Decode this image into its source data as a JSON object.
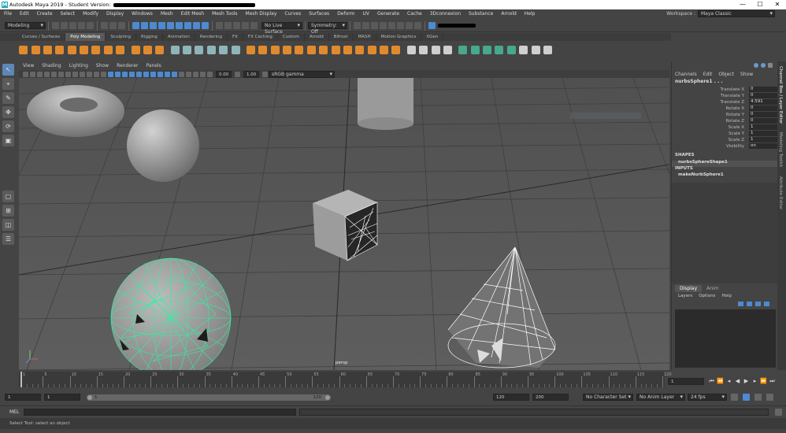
{
  "window": {
    "title": "Autodesk Maya 2019 - Student Version:",
    "logo_letter": "M",
    "minimize": "—",
    "maximize": "☐",
    "close": "✕"
  },
  "menus": [
    "File",
    "Edit",
    "Create",
    "Select",
    "Modify",
    "Display",
    "Windows",
    "Mesh",
    "Edit Mesh",
    "Mesh Tools",
    "Mesh Display",
    "Curves",
    "Surfaces",
    "Deform",
    "UV",
    "Generate",
    "Cache",
    "3Dconnexion",
    "Substance",
    "Arnold",
    "Help"
  ],
  "workspace": {
    "label": "Workspace :",
    "value": "Maya Classic"
  },
  "status_line": {
    "menu_set": "Modeling",
    "live_surface": "No Live Surface",
    "symmetry": "Symmetry: Off"
  },
  "shelf_tabs": [
    "Curves / Surfaces",
    "Poly Modeling",
    "Sculpting",
    "Rigging",
    "Animation",
    "Rendering",
    "FX",
    "FX Caching",
    "Custom",
    "Arnold",
    "Bifrost",
    "MASH",
    "Motion Graphics",
    "XGen"
  ],
  "active_shelf_tab": "Poly Modeling",
  "panel_menus": [
    "View",
    "Shading",
    "Lighting",
    "Show",
    "Renderer",
    "Panels"
  ],
  "panel_toolbar": {
    "exposure": "0.00",
    "gamma": "1.00",
    "color_space": "sRGB gamma"
  },
  "viewport": {
    "camera_label": "persp"
  },
  "channel_box": {
    "menus": [
      "Channels",
      "Edit",
      "Object",
      "Show"
    ],
    "node_name": "nurbsSphere1 . . .",
    "attributes": [
      {
        "name": "Translate X",
        "value": "0"
      },
      {
        "name": "Translate Y",
        "value": "0"
      },
      {
        "name": "Translate Z",
        "value": "4.591"
      },
      {
        "name": "Rotate X",
        "value": "0"
      },
      {
        "name": "Rotate Y",
        "value": "0"
      },
      {
        "name": "Rotate Z",
        "value": "0"
      },
      {
        "name": "Scale X",
        "value": "1"
      },
      {
        "name": "Scale Y",
        "value": "1"
      },
      {
        "name": "Scale Z",
        "value": "1"
      },
      {
        "name": "Visibility",
        "value": "on"
      }
    ],
    "shapes_header": "SHAPES",
    "shape_node": "nurbsSphereShape1",
    "inputs_header": "INPUTS",
    "input_node": "makeNurbSphere1"
  },
  "side_tabs": [
    "Channel Box / Layer Editor",
    "Modeling Toolkit",
    "Attribute Editor"
  ],
  "layer_editor": {
    "tabs": [
      "Display",
      "Anim"
    ],
    "menus": [
      "Layers",
      "Options",
      "Help"
    ]
  },
  "timeline": {
    "ticks": [
      "1",
      "5",
      "10",
      "15",
      "20",
      "25",
      "30",
      "35",
      "40",
      "45",
      "50",
      "55",
      "60",
      "65",
      "70",
      "75",
      "80",
      "85",
      "90",
      "95",
      "100",
      "105",
      "110",
      "115",
      "120"
    ],
    "current_frame": "1"
  },
  "range": {
    "start": "1",
    "playback_start": "1",
    "slider_start": "1",
    "slider_end": "120",
    "playback_end": "120",
    "end": "200",
    "character_set": "No Character Set",
    "anim_layer": "No Anim Layer",
    "fps": "24 fps"
  },
  "command_line": {
    "label": "MEL"
  },
  "help_line": {
    "text": "Select Tool: select an object"
  },
  "maya_logo": "M"
}
